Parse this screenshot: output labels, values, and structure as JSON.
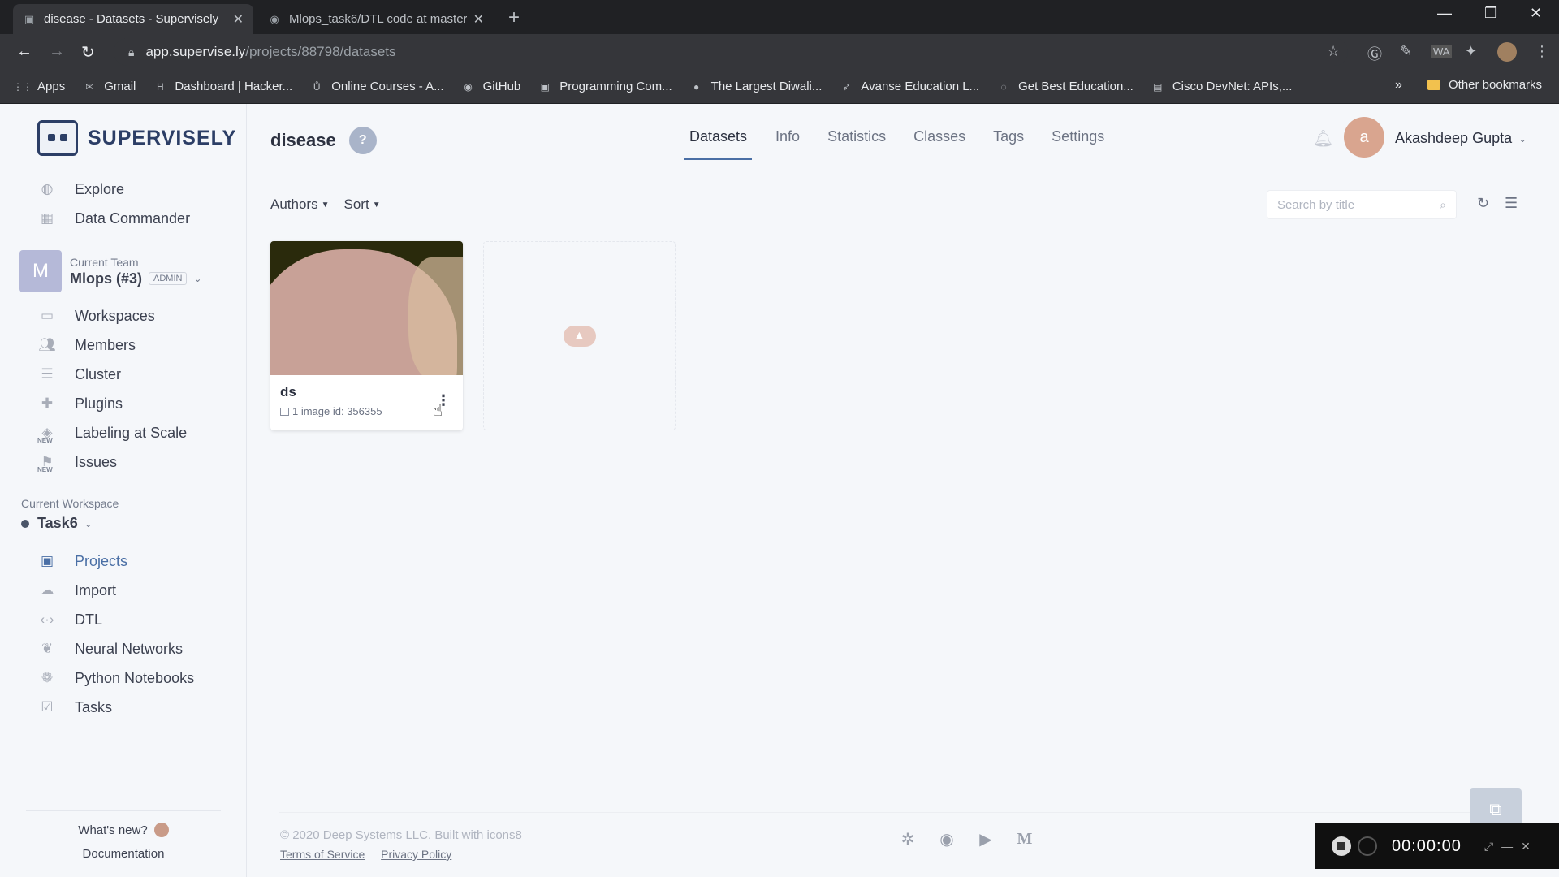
{
  "browser": {
    "tabs": [
      {
        "title": "disease - Datasets - Supervisely",
        "active": true
      },
      {
        "title": "Mlops_task6/DTL code at master",
        "active": false
      }
    ],
    "url_host": "app.supervise.ly",
    "url_path": "/projects/88798/datasets",
    "bookmarks": [
      {
        "label": "Apps",
        "icon": "apps-grid-icon"
      },
      {
        "label": "Gmail",
        "icon": "gmail-icon"
      },
      {
        "label": "Dashboard | Hacker...",
        "icon": "hackerrank-icon"
      },
      {
        "label": "Online Courses - A...",
        "icon": "udemy-icon"
      },
      {
        "label": "GitHub",
        "icon": "github-icon"
      },
      {
        "label": "Programming Com...",
        "icon": "codechef-icon"
      },
      {
        "label": "The Largest Diwali...",
        "icon": "site-icon"
      },
      {
        "label": "Avanse Education L...",
        "icon": "avanse-icon"
      },
      {
        "label": "Get Best Education...",
        "icon": "site-icon"
      },
      {
        "label": "Cisco DevNet: APIs,...",
        "icon": "cisco-icon"
      }
    ],
    "bookmarks_more": "»",
    "other_bookmarks": "Other bookmarks"
  },
  "sidebar": {
    "brand": "SUPERVISELY",
    "top_items": [
      {
        "label": "Explore",
        "icon": "globe-icon"
      },
      {
        "label": "Data Commander",
        "icon": "folder-icon"
      }
    ],
    "team_label": "Current Team",
    "team_name": "Mlops (#3)",
    "team_avatar": "M",
    "team_role": "ADMIN",
    "team_items": [
      {
        "label": "Workspaces",
        "icon": "monitor-icon"
      },
      {
        "label": "Members",
        "icon": "users-icon"
      },
      {
        "label": "Cluster",
        "icon": "server-icon"
      },
      {
        "label": "Plugins",
        "icon": "puzzle-icon"
      },
      {
        "label": "Labeling at Scale",
        "icon": "labeling-icon",
        "new": "NEW"
      },
      {
        "label": "Issues",
        "icon": "flag-icon",
        "new": "NEW"
      }
    ],
    "workspace_label": "Current Workspace",
    "workspace_name": "Task6",
    "workspace_items": [
      {
        "label": "Projects",
        "icon": "projects-icon",
        "active": true
      },
      {
        "label": "Import",
        "icon": "cloud-upload-icon"
      },
      {
        "label": "DTL",
        "icon": "code-icon"
      },
      {
        "label": "Neural Networks",
        "icon": "brain-icon"
      },
      {
        "label": "Python Notebooks",
        "icon": "python-icon"
      },
      {
        "label": "Tasks",
        "icon": "tasks-icon"
      }
    ],
    "whats_new": "What's new?",
    "documentation": "Documentation"
  },
  "header": {
    "project_title": "disease",
    "help": "?",
    "tabs": [
      "Datasets",
      "Info",
      "Statistics",
      "Classes",
      "Tags",
      "Settings"
    ],
    "active_tab": "Datasets",
    "user_initial": "a",
    "user_name": "Akashdeep Gupta"
  },
  "toolbar": {
    "authors": "Authors",
    "sort": "Sort",
    "search_placeholder": "Search by title"
  },
  "datasets": [
    {
      "name": "ds",
      "meta": "1 image id: 356355"
    }
  ],
  "footer": {
    "copyright": "© 2020 Deep Systems LLC. Built with icons8",
    "terms": "Terms of Service",
    "privacy": "Privacy Policy"
  },
  "recorder": {
    "time": "00:00:00"
  },
  "colors": {
    "accent": "#4a6fa5",
    "brand": "#2c3e66"
  }
}
